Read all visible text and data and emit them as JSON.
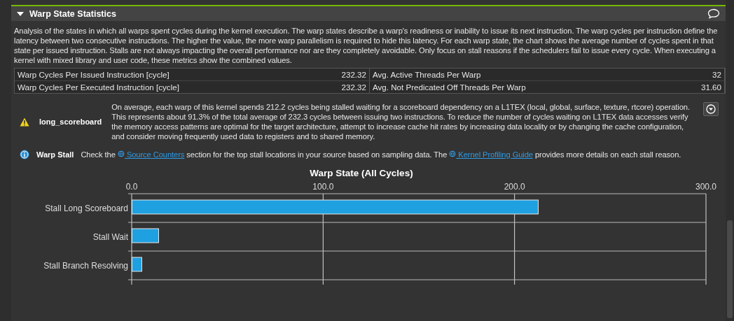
{
  "section": {
    "title": "Warp State Statistics",
    "expanded": true
  },
  "description": "Analysis of the states in which all warps spent cycles during the kernel execution. The warp states describe a warp's readiness or inability to issue its next instruction. The warp cycles per instruction define the latency between two consecutive instructions. The higher the value, the more warp parallelism is required to hide this latency. For each warp state, the chart shows the average number of cycles spent in that state per issued instruction. Stalls are not always impacting the overall performance nor are they completely avoidable. Only focus on stall reasons if the schedulers fail to issue every cycle. When executing a kernel with mixed library and user code, these metrics show the combined values.",
  "metrics": [
    {
      "left_label": "Warp Cycles Per Issued Instruction [cycle]",
      "left_value": "232.32",
      "right_label": "Avg. Active Threads Per Warp",
      "right_value": "32"
    },
    {
      "left_label": "Warp Cycles Per Executed Instruction [cycle]",
      "left_value": "232.32",
      "right_label": "Avg. Not Predicated Off Threads Per Warp",
      "right_value": "31.60"
    }
  ],
  "rules": [
    {
      "kind": "warning",
      "name": "long_scoreboard",
      "text": "On average, each warp of this kernel spends 212.2 cycles being stalled waiting for a scoreboard dependency on a L1TEX (local, global, surface, texture, rtcore) operation. This represents about 91.3% of the total average of 232.3 cycles between issuing two instructions. To reduce the number of cycles waiting on L1TEX data accesses verify the memory access patterns are optimal for the target architecture, attempt to increase cache hit rates by increasing data locality or by changing the cache configuration, and consider moving frequently used data to registers and to shared memory.",
      "expandable": true
    },
    {
      "kind": "info",
      "name": "Warp Stall",
      "parts": [
        {
          "kind": "text",
          "text": "Check the "
        },
        {
          "kind": "link",
          "text": "Source Counters"
        },
        {
          "kind": "text",
          "text": " section for the top stall locations in your source based on sampling data. The "
        },
        {
          "kind": "link",
          "text": "Kernel Profiling Guide"
        },
        {
          "kind": "text",
          "text": " provides more details on each stall reason."
        }
      ],
      "expandable": false
    }
  ],
  "chart_data": {
    "type": "bar",
    "orientation": "horizontal",
    "title": "Warp State (All Cycles)",
    "categories": [
      "Stall Long Scoreboard",
      "Stall Wait",
      "Stall Branch Resolving"
    ],
    "series": [
      {
        "color": "#1fa0e0",
        "values": [
          212.2,
          13.9,
          5.1
        ]
      }
    ],
    "xlim": [
      0,
      300
    ],
    "xticks": [
      {
        "value": 0,
        "label": "0.0"
      },
      {
        "value": 100,
        "label": "100.0"
      },
      {
        "value": 200,
        "label": "200.0"
      },
      {
        "value": 300,
        "label": "300.0"
      }
    ]
  }
}
